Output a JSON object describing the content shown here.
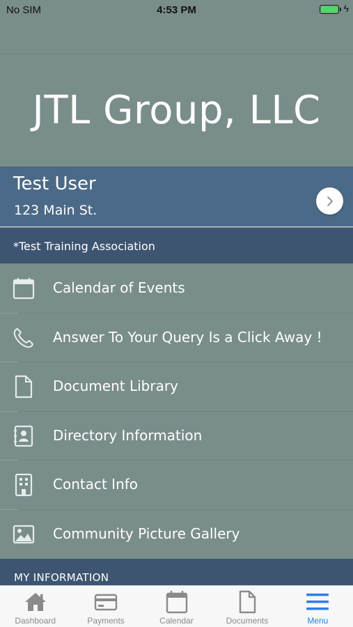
{
  "status_bar": {
    "carrier": "No SIM",
    "time": "4:53 PM",
    "battery_level": 1.0
  },
  "header": {
    "title": "JTL Group, LLC"
  },
  "user_card": {
    "name": "Test User",
    "address": "123 Main St."
  },
  "association": {
    "label": "*Test Training Association"
  },
  "menu": {
    "items": [
      {
        "label": "Calendar of Events",
        "icon": "calendar-icon"
      },
      {
        "label": "Answer To Your Query Is a Click Away !",
        "icon": "phone-icon"
      },
      {
        "label": "Document Library",
        "icon": "document-icon"
      },
      {
        "label": "Directory Information",
        "icon": "contact-book-icon"
      },
      {
        "label": "Contact Info",
        "icon": "building-icon"
      },
      {
        "label": "Community Picture Gallery",
        "icon": "image-icon"
      }
    ]
  },
  "section": {
    "label": "MY INFORMATION"
  },
  "tab_bar": {
    "tabs": [
      {
        "label": "Dashboard",
        "icon": "home-icon"
      },
      {
        "label": "Payments",
        "icon": "credit-card-icon"
      },
      {
        "label": "Calendar",
        "icon": "calendar-icon"
      },
      {
        "label": "Documents",
        "icon": "document-icon"
      },
      {
        "label": "Menu",
        "icon": "hamburger-menu-icon",
        "active": true
      }
    ]
  },
  "colors": {
    "background": "#798d8b",
    "user_card": "#4b6a87",
    "section_bar": "#3d5570",
    "tab_active": "#2d7ee8",
    "tab_inactive": "#8a8a8a"
  }
}
